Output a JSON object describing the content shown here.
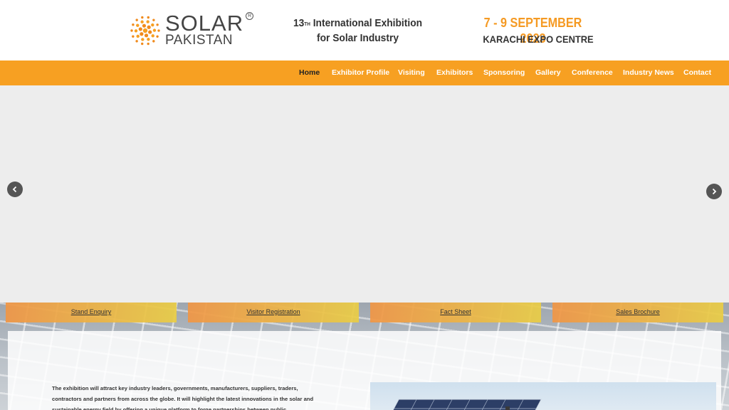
{
  "header": {
    "logo_title": "SOLAR",
    "logo_subtitle": "PAKISTAN",
    "logo_reg_mark": "R",
    "tagline_number": "13",
    "tagline_suffix": "TH",
    "tagline_line1_rest": " International Exhibition",
    "tagline_line2": "for Solar Industry",
    "event_date": "7 - 9 SEPTEMBER 2023",
    "event_venue": "KARACHI EXPO CENTRE"
  },
  "nav": {
    "items": [
      {
        "label": "Home",
        "active": true
      },
      {
        "label": "Exhibitor Profile"
      },
      {
        "label": "Visiting"
      },
      {
        "label": "Exhibitors"
      },
      {
        "label": "Sponsoring"
      },
      {
        "label": "Gallery"
      },
      {
        "label": "Conference"
      },
      {
        "label": "Industry News"
      },
      {
        "label": "Contact"
      }
    ]
  },
  "slider": {
    "prev_icon": "chevron-left-icon",
    "next_icon": "chevron-right-icon"
  },
  "quick_links": [
    {
      "label": "Stand Enquiry"
    },
    {
      "label": "Visitor Registration"
    },
    {
      "label": "Fact Sheet"
    },
    {
      "label": "Sales Brochure"
    }
  ],
  "intro": {
    "text": "The exhibition will attract key industry leaders, governments, manufacturers, suppliers, traders, contractors and partners from across the globe. It will highlight the latest innovations in the solar and sustainable energy field by offering a unique platform to forge partnerships between public"
  },
  "colors": {
    "brand_orange": "#f7a022",
    "date_orange": "#f59a23",
    "slider_bg": "#ededed",
    "arrow_bg": "#555555"
  }
}
